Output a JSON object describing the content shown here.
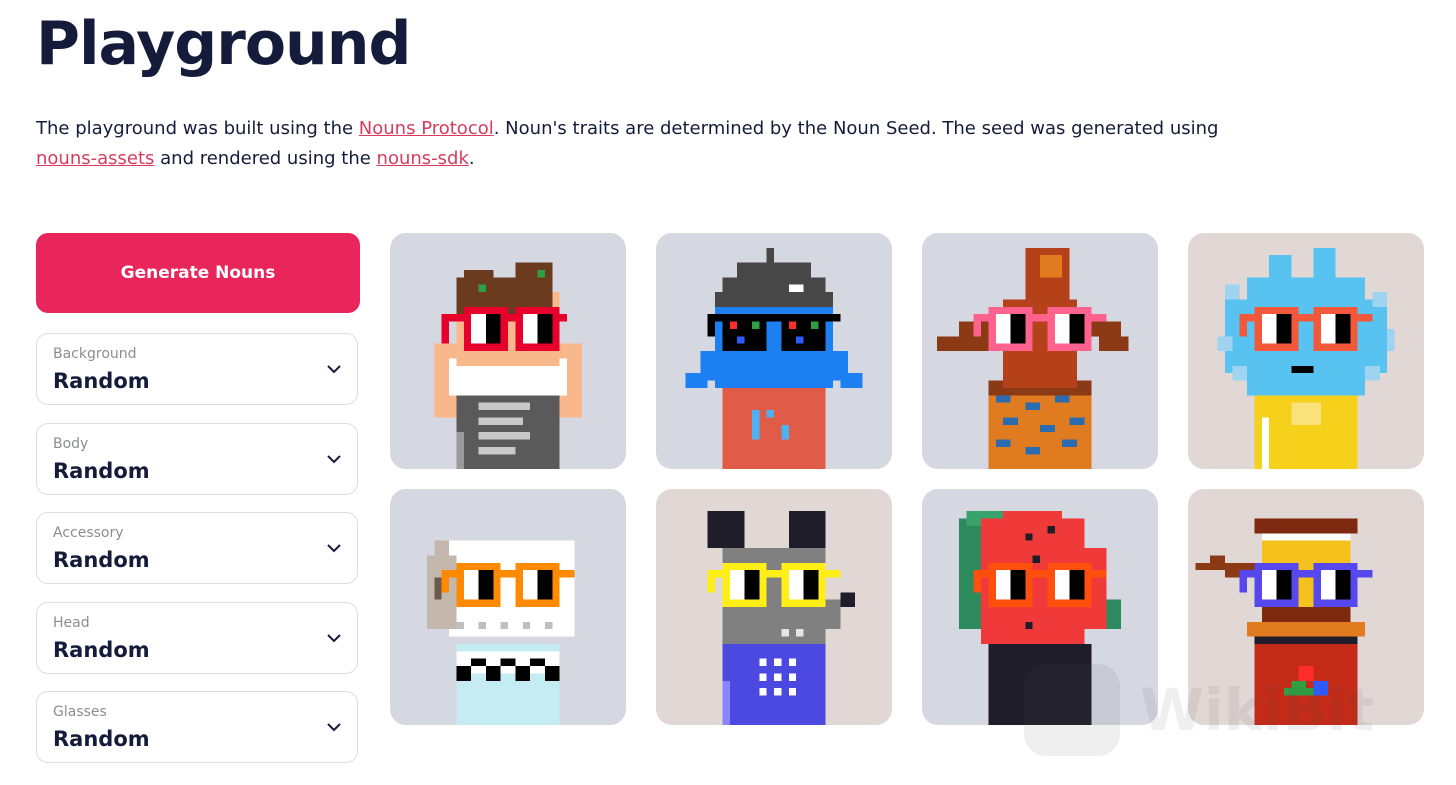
{
  "page": {
    "title": "Playground",
    "intro": {
      "t1": "The playground was built using the ",
      "link1": "Nouns Protocol",
      "t2": ". Noun's traits are determined by the Noun Seed. The seed was generated using ",
      "link2": "nouns-assets",
      "t3": " and rendered using the ",
      "link3": "nouns-sdk",
      "t4": "."
    }
  },
  "controls": {
    "generate_label": "Generate Nouns",
    "selects": [
      {
        "label": "Background",
        "value": "Random"
      },
      {
        "label": "Body",
        "value": "Random"
      },
      {
        "label": "Accessory",
        "value": "Random"
      },
      {
        "label": "Head",
        "value": "Random"
      },
      {
        "label": "Glasses",
        "value": "Random"
      }
    ]
  },
  "colors": {
    "accent": "#e9265c",
    "link": "#d63c5e",
    "cool_bg": "#d5d7e1",
    "warm_bg": "#e1d7d5",
    "text": "#151c3b"
  },
  "nouns": [
    {
      "background": "#d5d7e1",
      "head": "hair-icon",
      "glasses": "#e8002d",
      "body": "#5a5a5a"
    },
    {
      "background": "#d5d7e1",
      "head": "blue-blob-icon",
      "glasses": "#000000",
      "body": "#e05b48"
    },
    {
      "background": "#d5d7e1",
      "head": "witch-hat-icon",
      "glasses": "#ff638d",
      "body": "#e07b20"
    },
    {
      "background": "#e1d7d5",
      "head": "blue-splash-icon",
      "glasses": "#f4583a",
      "body": "#f5d11c"
    },
    {
      "background": "#d5d7e1",
      "head": "skull-icon",
      "glasses": "#ff8a00",
      "body": "#c5ebf3"
    },
    {
      "background": "#e1d7d5",
      "head": "mouse-icon",
      "glasses": "#ffef16",
      "body": "#4b49e0"
    },
    {
      "background": "#d5d7e1",
      "head": "watermelon-icon",
      "glasses": "#fe500c",
      "body": "#1f1d29"
    },
    {
      "background": "#e1d7d5",
      "head": "stacked-cake-icon",
      "glasses": "#5648ed",
      "body": "#c32b18"
    }
  ],
  "watermark_text": "WikiBit"
}
